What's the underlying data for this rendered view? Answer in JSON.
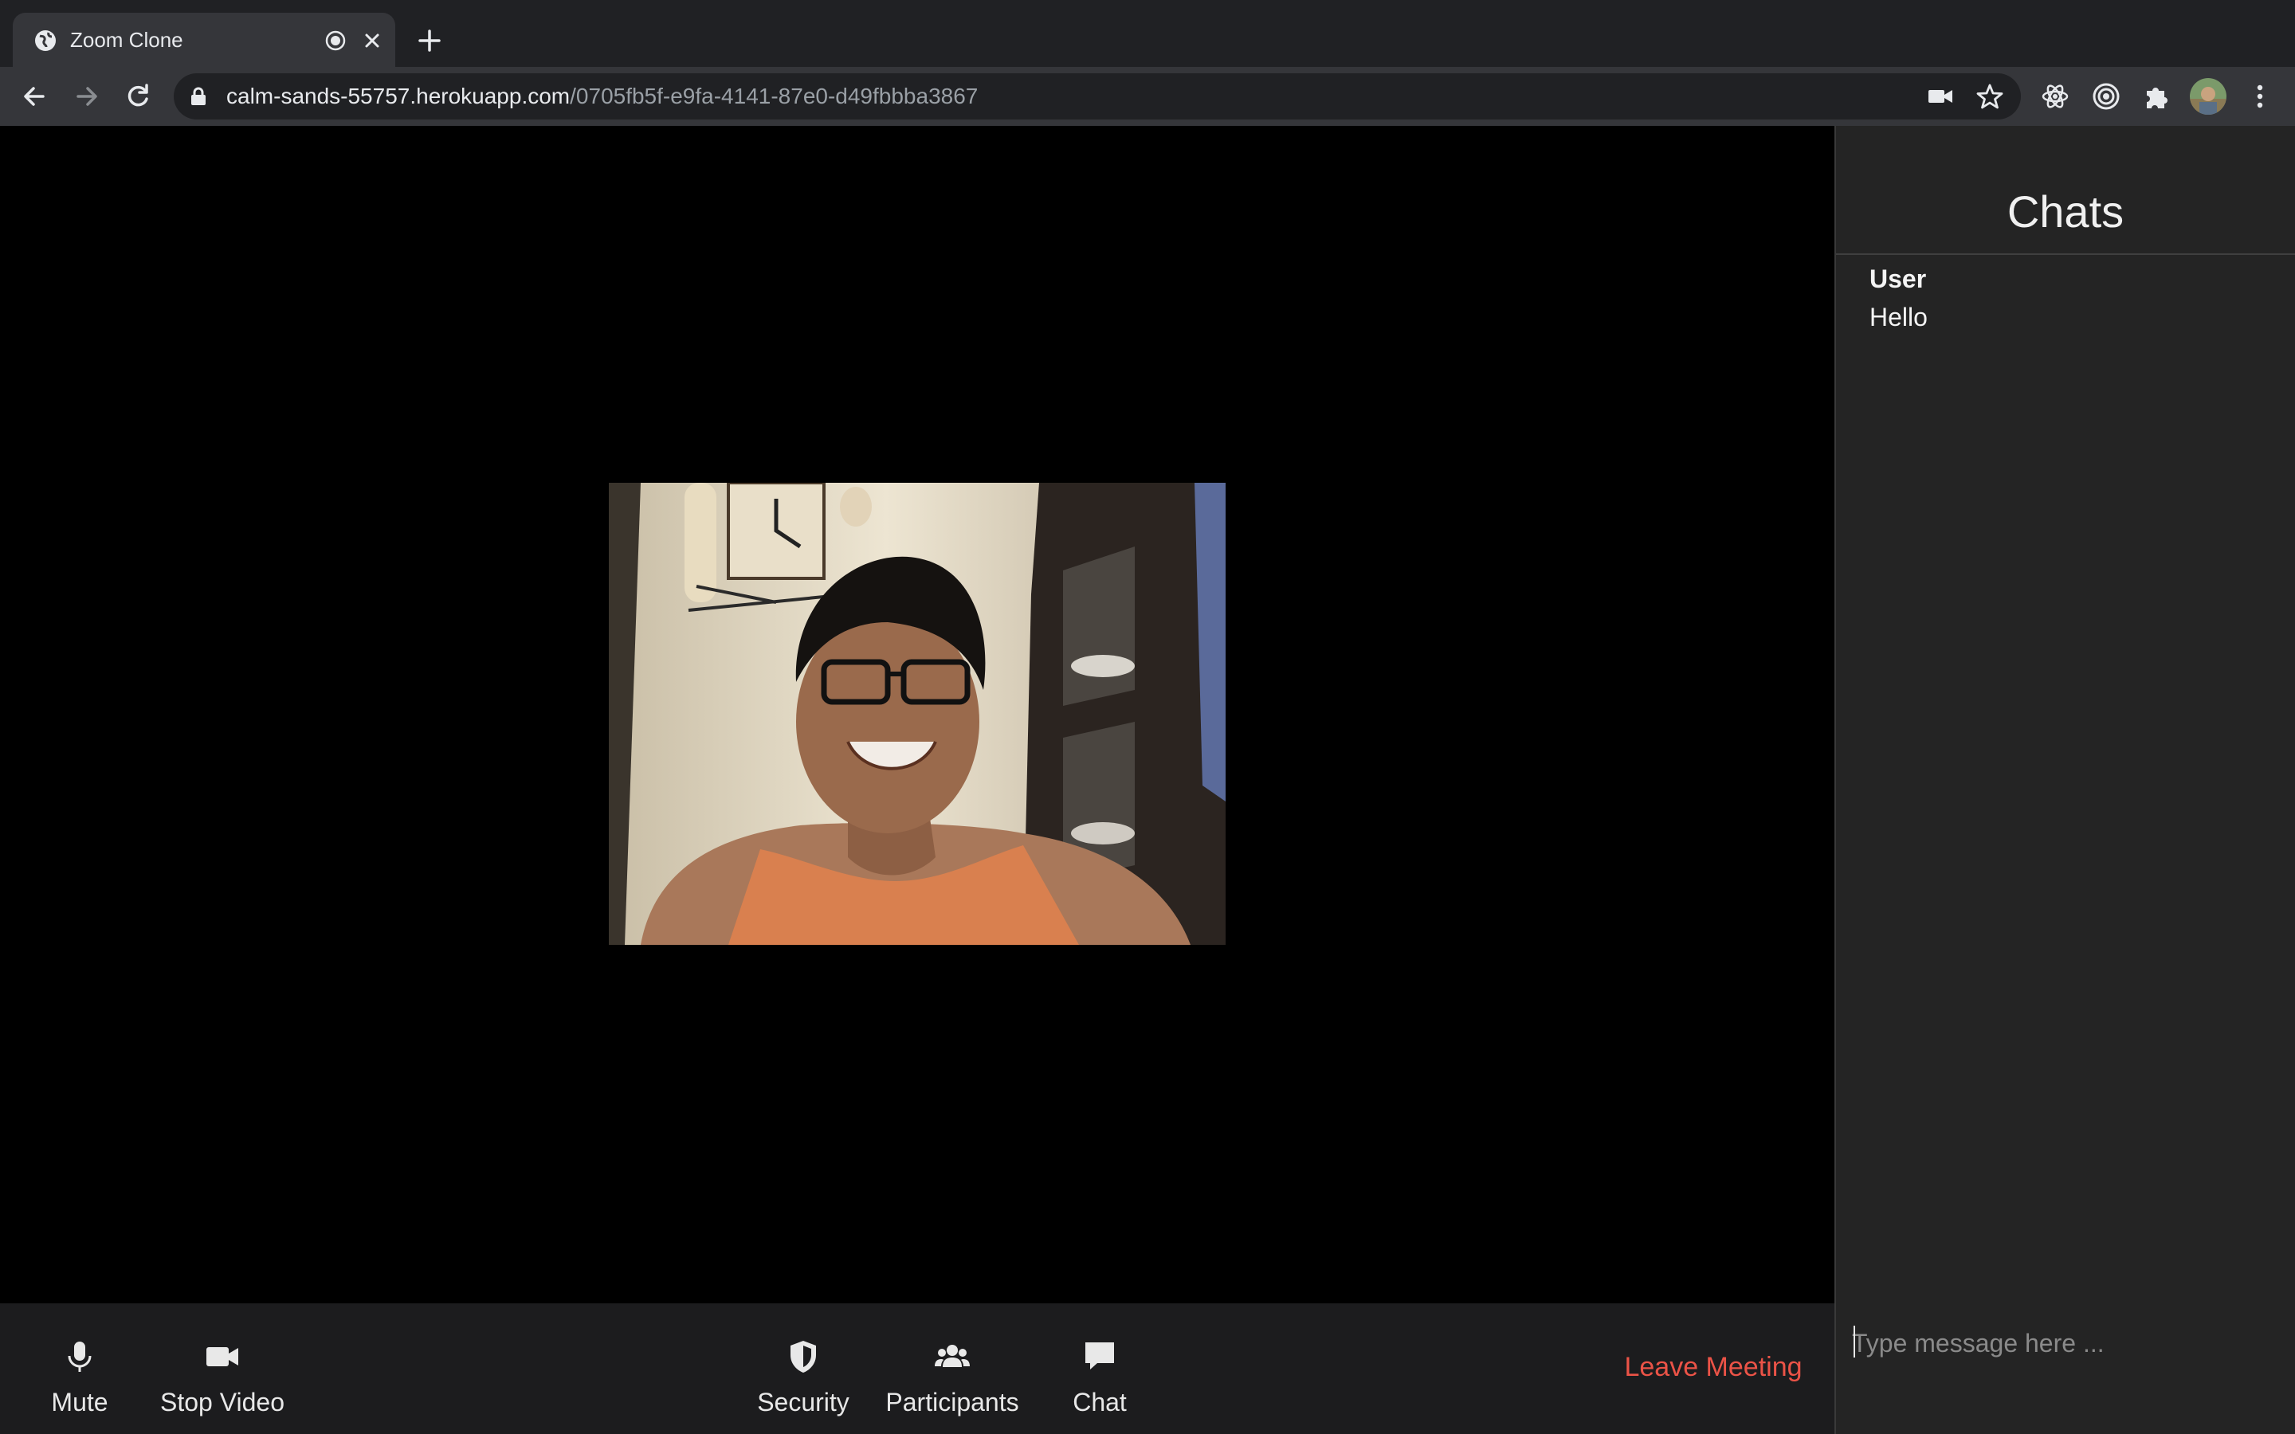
{
  "browser": {
    "tab": {
      "title": "Zoom Clone"
    },
    "url": {
      "host": "calm-sands-55757.herokuapp.com",
      "path": "/0705fb5f-e9fa-4141-87e0-d49fbbba3867"
    }
  },
  "meeting": {
    "controls": [
      {
        "id": "mute",
        "label": "Mute",
        "icon": "microphone-icon"
      },
      {
        "id": "stop-video",
        "label": "Stop Video",
        "icon": "video-camera-icon"
      },
      {
        "id": "security",
        "label": "Security",
        "icon": "shield-icon"
      },
      {
        "id": "participants",
        "label": "Participants",
        "icon": "users-icon"
      },
      {
        "id": "chat",
        "label": "Chat",
        "icon": "chat-bubble-icon"
      }
    ],
    "leave_label": "Leave Meeting",
    "leave_color": "#eb5347"
  },
  "chat": {
    "title": "Chats",
    "messages": [
      {
        "user": "User",
        "text": "Hello"
      }
    ],
    "input_placeholder": "Type message here ..."
  }
}
